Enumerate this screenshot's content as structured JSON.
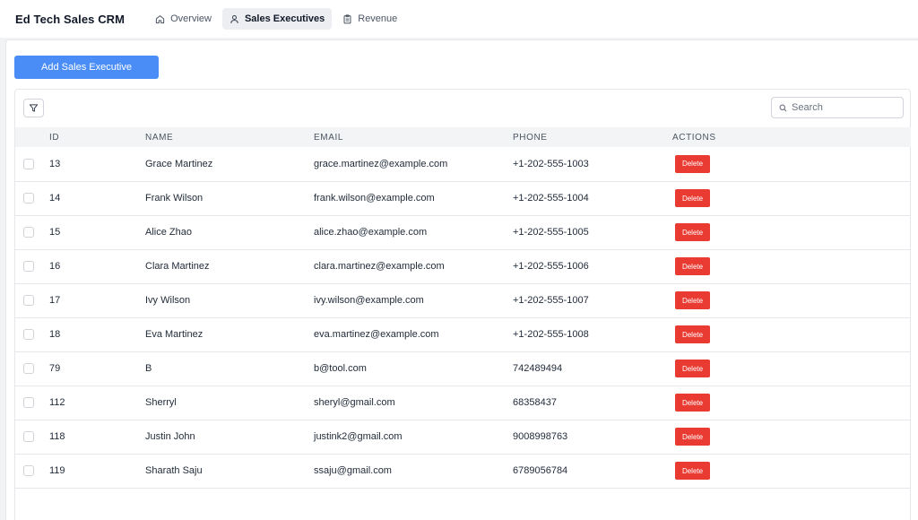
{
  "app": {
    "title": "Ed Tech Sales CRM"
  },
  "nav": {
    "tabs": [
      {
        "label": "Overview",
        "icon": "home-icon",
        "active": false
      },
      {
        "label": "Sales Executives",
        "icon": "user-icon",
        "active": true
      },
      {
        "label": "Revenue",
        "icon": "clipboard-icon",
        "active": false
      }
    ]
  },
  "toolbar": {
    "add_label": "Add Sales Executive",
    "search_placeholder": "Search"
  },
  "table": {
    "headers": [
      "ID",
      "NAME",
      "EMAIL",
      "PHONE",
      "ACTIONS"
    ],
    "delete_label": "Delete",
    "rows": [
      {
        "id": "13",
        "name": "Grace Martinez",
        "email": "grace.martinez@example.com",
        "phone": "+1-202-555-1003"
      },
      {
        "id": "14",
        "name": "Frank Wilson",
        "email": "frank.wilson@example.com",
        "phone": "+1-202-555-1004"
      },
      {
        "id": "15",
        "name": "Alice Zhao",
        "email": "alice.zhao@example.com",
        "phone": "+1-202-555-1005"
      },
      {
        "id": "16",
        "name": "Clara Martinez",
        "email": "clara.martinez@example.com",
        "phone": "+1-202-555-1006"
      },
      {
        "id": "17",
        "name": "Ivy Wilson",
        "email": "ivy.wilson@example.com",
        "phone": "+1-202-555-1007"
      },
      {
        "id": "18",
        "name": "Eva Martinez",
        "email": "eva.martinez@example.com",
        "phone": "+1-202-555-1008"
      },
      {
        "id": "79",
        "name": "B",
        "email": "b@tool.com",
        "phone": "742489494"
      },
      {
        "id": "112",
        "name": "Sherryl",
        "email": "sheryl@gmail.com",
        "phone": "68358437"
      },
      {
        "id": "118",
        "name": "Justin John",
        "email": "justink2@gmail.com",
        "phone": "9008998763"
      },
      {
        "id": "119",
        "name": "Sharath Saju",
        "email": "ssaju@gmail.com",
        "phone": "6789056784"
      }
    ]
  },
  "colors": {
    "primary": "#4a8df6",
    "danger": "#ea3b33",
    "header_bg": "#f3f4f6",
    "page_bg": "#f2f3f5"
  }
}
